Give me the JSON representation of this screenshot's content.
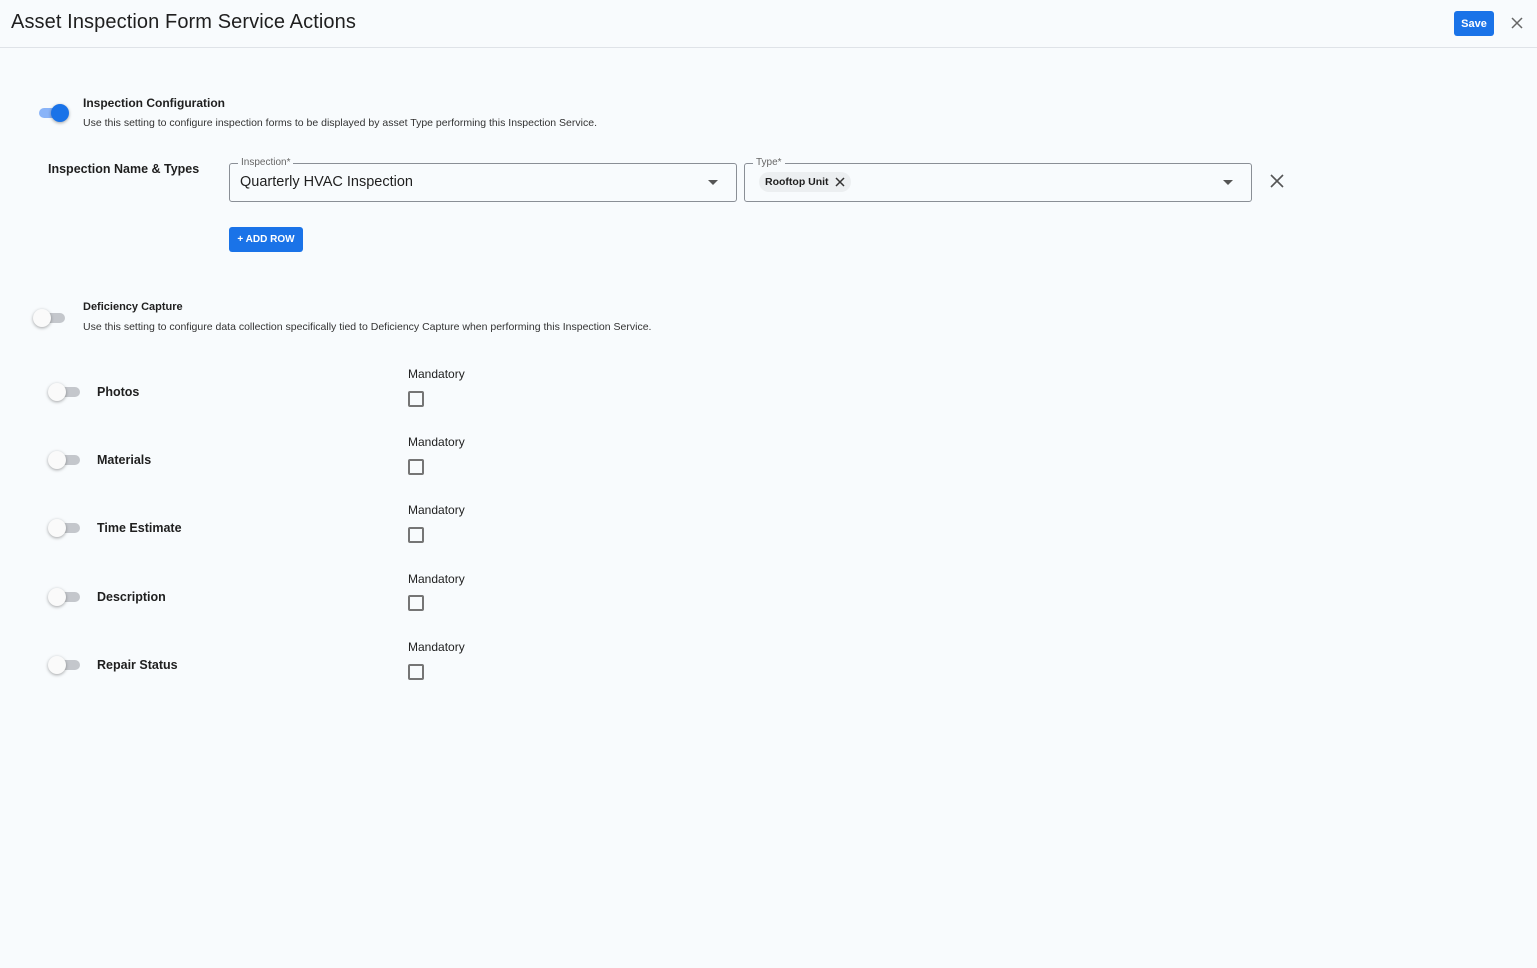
{
  "header": {
    "title": "Asset Inspection Form Service Actions",
    "save_label": "Save"
  },
  "inspection_config": {
    "title": "Inspection Configuration",
    "description": "Use this setting to configure inspection forms to be displayed by asset Type performing this Inspection Service.",
    "enabled": true,
    "row_label": "Inspection Name & Types",
    "inspection_field": {
      "legend": "Inspection*",
      "value": "Quarterly HVAC Inspection"
    },
    "type_field": {
      "legend": "Type*",
      "chips": [
        "Rooftop Unit"
      ]
    },
    "add_row_label": "+ ADD ROW"
  },
  "deficiency_capture": {
    "title": "Deficiency Capture",
    "description": "Use this setting to configure data collection specifically tied to Deficiency Capture when performing this Inspection Service.",
    "enabled": false,
    "items": [
      {
        "label": "Photos",
        "mandatory_label": "Mandatory",
        "enabled": false,
        "mandatory": false
      },
      {
        "label": "Materials",
        "mandatory_label": "Mandatory",
        "enabled": false,
        "mandatory": false
      },
      {
        "label": "Time Estimate",
        "mandatory_label": "Mandatory",
        "enabled": false,
        "mandatory": false
      },
      {
        "label": "Description",
        "mandatory_label": "Mandatory",
        "enabled": false,
        "mandatory": false
      },
      {
        "label": "Repair Status",
        "mandatory_label": "Mandatory",
        "enabled": false,
        "mandatory": false
      }
    ]
  },
  "colors": {
    "accent": "#1a73e8",
    "background": "#f8fbfd"
  }
}
